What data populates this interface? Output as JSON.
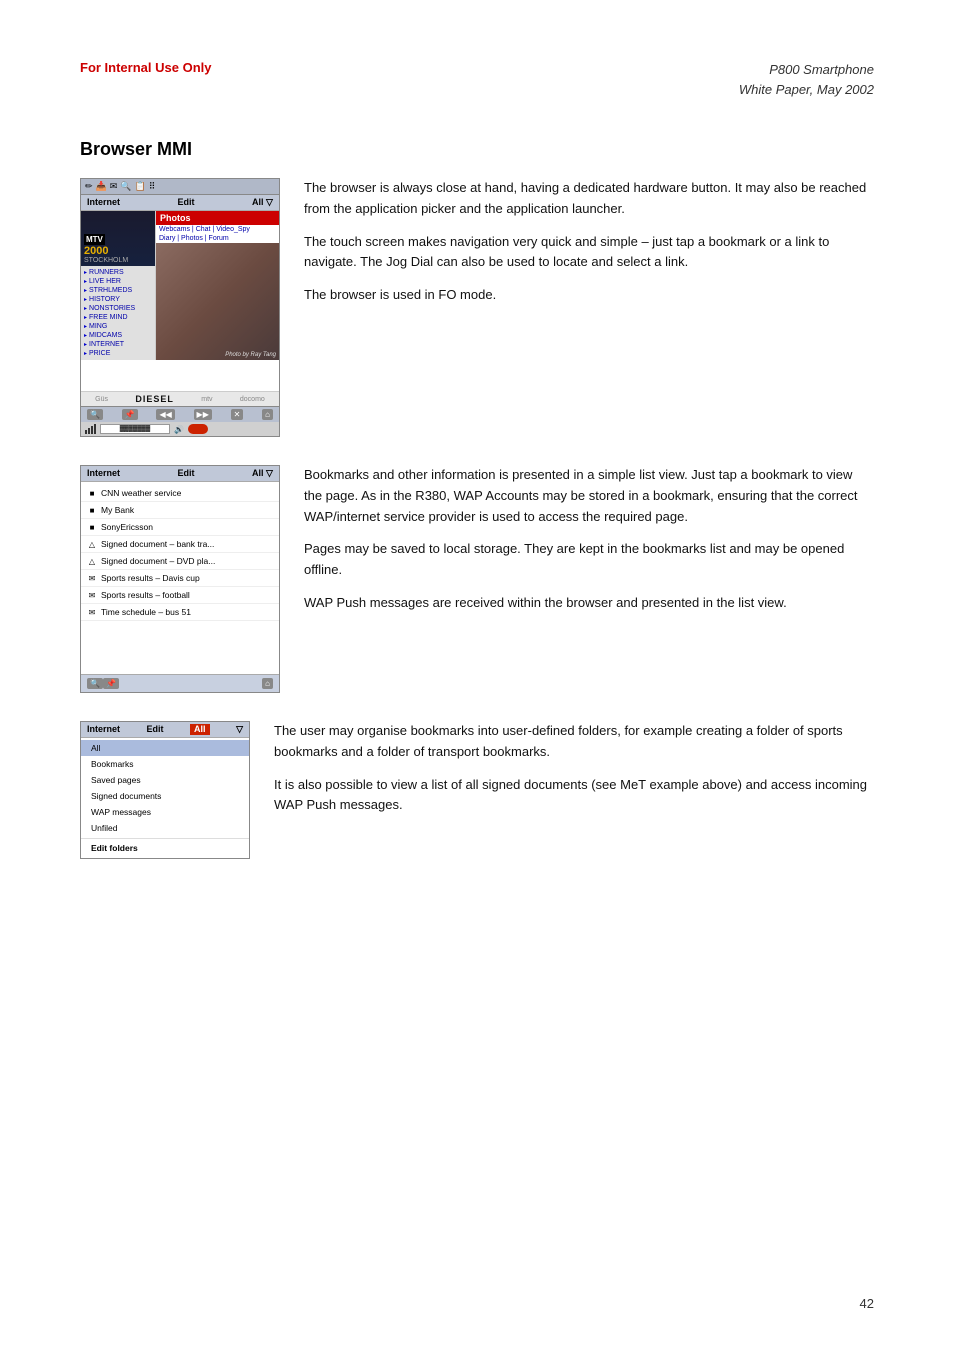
{
  "header": {
    "left_label": "For Internal Use Only",
    "right_line1": "P800 Smartphone",
    "right_line2": "White Paper, May 2002"
  },
  "section": {
    "title": "Browser MMI"
  },
  "block1": {
    "description_paragraphs": [
      "The browser is always close at hand, having a dedicated hardware button. It may also be reached from the application picker and the application launcher.",
      "The touch screen makes navigation very quick and simple – just tap a bookmark or a link to navigate. The Jog Dial can also be used to locate and select a link.",
      "The browser is used in FO mode."
    ],
    "phone": {
      "menu_bar": {
        "left": "Internet",
        "center": "Edit",
        "right": "All ▽"
      },
      "left_panel": {
        "year": "2000",
        "city": "STOCKHOLM"
      },
      "right_panel": {
        "header": "Photos",
        "sub_links": "Webcams | Chat | Video_Spy",
        "sub_links2": "Diary | Photos | Forum"
      },
      "links": [
        "RUNNERS",
        "LIVE HER",
        "STRHLMEDS",
        "HISTORY",
        "NONSTORIES",
        "FREE MIND",
        "MING",
        "MIDCAMS",
        "INTERNET",
        "PRICE"
      ],
      "photo_caption": "Photo by Ray Tang",
      "bottom_logos": [
        "Diesel",
        "MTV",
        "Docomo"
      ]
    }
  },
  "block2": {
    "description_paragraphs": [
      "Bookmarks and other information is presented in a simple list view. Just tap a bookmark to view the page. As in the R380, WAP Accounts may be stored in a bookmark, ensuring that the correct WAP/internet service provider is used to access the required page.",
      "Pages may be saved to local storage. They are kept in the bookmarks list and may be opened offline.",
      "WAP Push messages are received within the browser and presented in the list view."
    ],
    "phone": {
      "menu_bar": {
        "left": "Internet",
        "center": "Edit",
        "right": "All ▽"
      },
      "bookmarks": [
        {
          "icon": "■",
          "text": "CNN weather service"
        },
        {
          "icon": "■",
          "text": "My Bank"
        },
        {
          "icon": "■",
          "text": "SonyEricsson"
        },
        {
          "icon": "▲",
          "text": "Signed document – bank tra..."
        },
        {
          "icon": "▲",
          "text": "Signed document – DVD pla..."
        },
        {
          "icon": "✉",
          "text": "Sports results – Davis cup"
        },
        {
          "icon": "✉",
          "text": "Sports results – football"
        },
        {
          "icon": "✉",
          "text": "Time schedule – bus 51"
        }
      ]
    }
  },
  "block3": {
    "description_paragraphs": [
      "The user may organise bookmarks into user-defined folders, for example creating a folder of sports bookmarks and a folder of transport bookmarks.",
      "It is also possible to view a list of all signed documents (see MeT example above) and access incoming WAP Push messages."
    ],
    "phone": {
      "menu_bar": {
        "left": "Internet",
        "center": "Edit",
        "right_selected": "All"
      },
      "menu_items": [
        {
          "text": "All",
          "highlighted": true
        },
        {
          "text": "Bookmarks",
          "highlighted": false
        },
        {
          "text": "Saved pages",
          "highlighted": false
        },
        {
          "text": "Signed documents",
          "highlighted": false
        },
        {
          "text": "WAP messages",
          "highlighted": false
        },
        {
          "text": "Unfiled",
          "highlighted": false
        },
        {
          "text": "Edit folders",
          "section": true,
          "highlighted": false
        }
      ]
    }
  },
  "page_number": "42"
}
